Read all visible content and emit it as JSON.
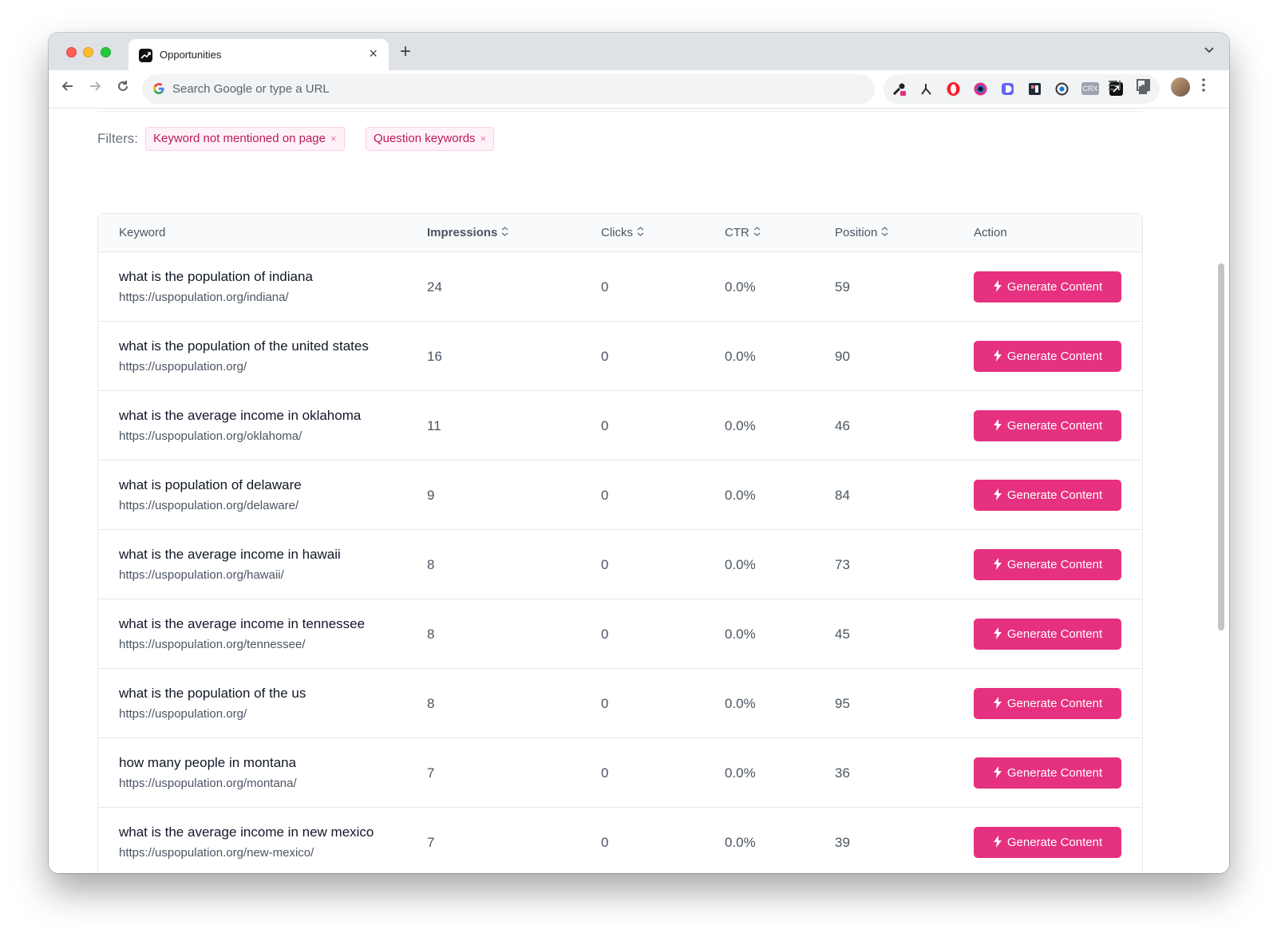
{
  "browser": {
    "tab_title": "Opportunities",
    "tab_close": "×",
    "new_tab": "+",
    "omnibox_placeholder": "Search Google or type a URL",
    "crx_label": "CRX"
  },
  "filters": {
    "label": "Filters:",
    "chips": [
      {
        "label": "Keyword not mentioned on page",
        "remove": "×"
      },
      {
        "label": "Question keywords",
        "remove": "×"
      }
    ]
  },
  "table": {
    "columns": {
      "keyword": "Keyword",
      "impressions": "Impressions",
      "clicks": "Clicks",
      "ctr": "CTR",
      "position": "Position",
      "action": "Action"
    },
    "action_label": "Generate Content",
    "rows": [
      {
        "keyword": "what is the population of indiana",
        "url": "https://uspopulation.org/indiana/",
        "impressions": "24",
        "clicks": "0",
        "ctr": "0.0%",
        "position": "59"
      },
      {
        "keyword": "what is the population of the united states",
        "url": "https://uspopulation.org/",
        "impressions": "16",
        "clicks": "0",
        "ctr": "0.0%",
        "position": "90"
      },
      {
        "keyword": "what is the average income in oklahoma",
        "url": "https://uspopulation.org/oklahoma/",
        "impressions": "11",
        "clicks": "0",
        "ctr": "0.0%",
        "position": "46"
      },
      {
        "keyword": "what is population of delaware",
        "url": "https://uspopulation.org/delaware/",
        "impressions": "9",
        "clicks": "0",
        "ctr": "0.0%",
        "position": "84"
      },
      {
        "keyword": "what is the average income in hawaii",
        "url": "https://uspopulation.org/hawaii/",
        "impressions": "8",
        "clicks": "0",
        "ctr": "0.0%",
        "position": "73"
      },
      {
        "keyword": "what is the average income in tennessee",
        "url": "https://uspopulation.org/tennessee/",
        "impressions": "8",
        "clicks": "0",
        "ctr": "0.0%",
        "position": "45"
      },
      {
        "keyword": "what is the population of the us",
        "url": "https://uspopulation.org/",
        "impressions": "8",
        "clicks": "0",
        "ctr": "0.0%",
        "position": "95"
      },
      {
        "keyword": "how many people in montana",
        "url": "https://uspopulation.org/montana/",
        "impressions": "7",
        "clicks": "0",
        "ctr": "0.0%",
        "position": "36"
      },
      {
        "keyword": "what is the average income in new mexico",
        "url": "https://uspopulation.org/new-mexico/",
        "impressions": "7",
        "clicks": "0",
        "ctr": "0.0%",
        "position": "39"
      }
    ]
  },
  "colors": {
    "accent": "#e5317f",
    "chip_text": "#be185d",
    "chip_bg": "#fdf2f8"
  }
}
